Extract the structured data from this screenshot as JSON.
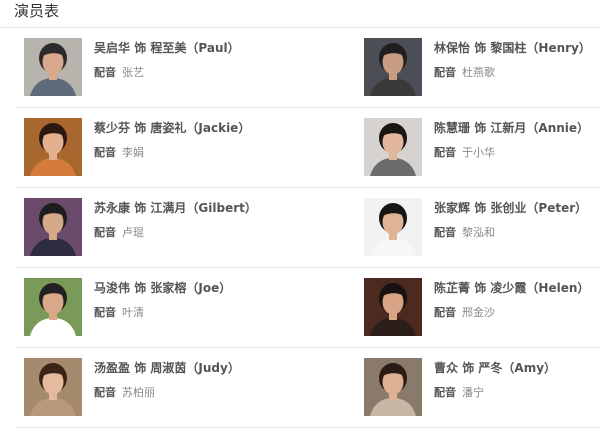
{
  "section": {
    "title": "演员表"
  },
  "cast": [
    {
      "actor": "吴启华",
      "role_word": "饰",
      "character": "程至美（Paul）",
      "voice_label": "配音",
      "voice_actor": "张艺",
      "photo": {
        "bg": "#b7b3ad",
        "skin": "#d8a98c",
        "hair": "#2b2b2b",
        "clothes": "#5c6a7a"
      }
    },
    {
      "actor": "林保怡",
      "role_word": "饰",
      "character": "黎国柱（Henry）",
      "voice_label": "配音",
      "voice_actor": "杜燕歌",
      "photo": {
        "bg": "#4b4f55",
        "skin": "#c99d83",
        "hair": "#1f1f1f",
        "clothes": "#3a3a3a"
      }
    },
    {
      "actor": "蔡少芬",
      "role_word": "饰",
      "character": "唐姿礼（Jackie）",
      "voice_label": "配音",
      "voice_actor": "李娟",
      "photo": {
        "bg": "#a8672f",
        "skin": "#e4b08f",
        "hair": "#2a1a12",
        "clothes": "#d27b3b"
      }
    },
    {
      "actor": "陈慧珊",
      "role_word": "饰",
      "character": "江新月（Annie）",
      "voice_label": "配音",
      "voice_actor": "于小华",
      "photo": {
        "bg": "#d6d2cf",
        "skin": "#e2b69d",
        "hair": "#1a1515",
        "clothes": "#6b6b6b"
      }
    },
    {
      "actor": "苏永康",
      "role_word": "饰",
      "character": "江满月（Gilbert）",
      "voice_label": "配音",
      "voice_actor": "卢琨",
      "photo": {
        "bg": "#6a4b6b",
        "skin": "#d6a88a",
        "hair": "#1d1d1d",
        "clothes": "#2d2d3f"
      }
    },
    {
      "actor": "张家辉",
      "role_word": "饰",
      "character": "张创业（Peter）",
      "voice_label": "配音",
      "voice_actor": "黎泓和",
      "photo": {
        "bg": "#f2f2f2",
        "skin": "#e0b394",
        "hair": "#151515",
        "clothes": "#f7f7f7"
      }
    },
    {
      "actor": "马浚伟",
      "role_word": "饰",
      "character": "张家榕（Joe）",
      "voice_label": "配音",
      "voice_actor": "叶清",
      "photo": {
        "bg": "#7a9a5a",
        "skin": "#d9a98a",
        "hair": "#222222",
        "clothes": "#ffffff"
      }
    },
    {
      "actor": "陈芷菁",
      "role_word": "饰",
      "character": "凌少霞（Helen）",
      "voice_label": "配音",
      "voice_actor": "邢金沙",
      "photo": {
        "bg": "#4c2a20",
        "skin": "#d9a486",
        "hair": "#1a1212",
        "clothes": "#2a1d1a"
      }
    },
    {
      "actor": "汤盈盈",
      "role_word": "饰",
      "character": "周淑茵（Judy）",
      "voice_label": "配音",
      "voice_actor": "苏柏丽",
      "photo": {
        "bg": "#a58a6d",
        "skin": "#e6bb9d",
        "hair": "#3a2418",
        "clothes": "#b79a7c"
      }
    },
    {
      "actor": "曹众",
      "role_word": "饰",
      "character": "严冬（Amy）",
      "voice_label": "配音",
      "voice_actor": "潘宁",
      "photo": {
        "bg": "#8a7a6c",
        "skin": "#deb094",
        "hair": "#2b1b15",
        "clothes": "#c8b7a5"
      }
    }
  ]
}
